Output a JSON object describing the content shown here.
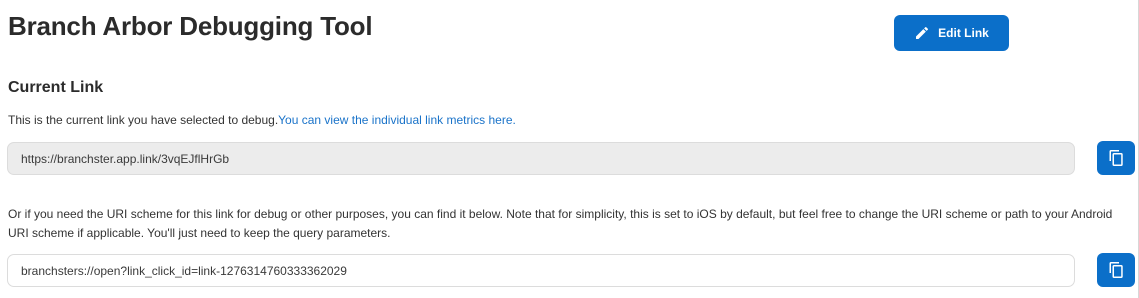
{
  "page": {
    "title": "Branch Arbor Debugging Tool"
  },
  "toolbar": {
    "edit_label": "Edit Link",
    "edit_icon": "pencil-icon"
  },
  "current_link": {
    "heading": "Current Link",
    "description": "This is the current link you have selected to debug.",
    "metrics_link": "You can view the individual link metrics here.",
    "url": "https://branchster.app.link/3vqEJflHrGb",
    "copy_icon": "copy-icon"
  },
  "uri_scheme": {
    "description": "Or if you need the URI scheme for this link for debug or other purposes, you can find it below. Note that for simplicity, this is set to iOS by default, but feel free to change the URI scheme or path to your Android URI scheme if applicable. You'll just need to keep the query parameters.",
    "value": "branchsters://open?link_click_id=link-1276314760333362029",
    "copy_icon": "copy-icon"
  },
  "colors": {
    "accent": "#0b6fc9",
    "link": "#1a73c9",
    "readonly_bg": "#ececec"
  }
}
